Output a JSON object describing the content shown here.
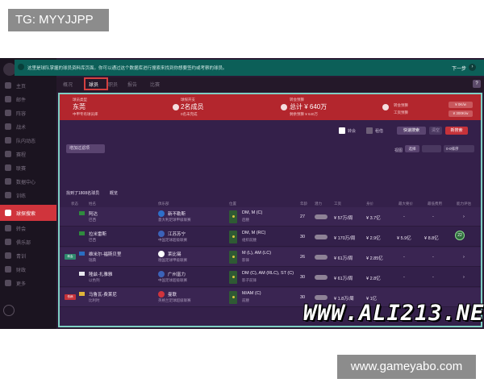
{
  "labels": {
    "tg": "TG: MYYJJPP",
    "site": "www.gameyabo.com",
    "watermark": "WWW.ALI213.NET"
  },
  "banner": {
    "text": "这里是球队掌握的球员资料库页面。你可以通过这个数据库进行搜索来找到你想要签约或考察的球员。",
    "next_label": "下一步",
    "next_icon": "chevron-right-icon"
  },
  "sidebar": {
    "items": [
      {
        "label": "主页"
      },
      {
        "label": "邮件"
      },
      {
        "label": "阵容"
      },
      {
        "label": "战术"
      },
      {
        "label": "队内动态"
      },
      {
        "label": "赛程"
      },
      {
        "label": "联赛"
      },
      {
        "label": "数据中心"
      },
      {
        "label": "训练"
      },
      {
        "label": "医疗"
      },
      {
        "label": "球探搜索"
      },
      {
        "label": "转会"
      },
      {
        "label": "俱乐部"
      },
      {
        "label": "青训"
      },
      {
        "label": "财政"
      },
      {
        "label": "更多"
      }
    ],
    "active_index": 10
  },
  "tabs": [
    {
      "label": "概况"
    },
    {
      "label": "球员"
    },
    {
      "label": "职员"
    },
    {
      "label": "报告"
    },
    {
      "label": "比赛"
    }
  ],
  "header": {
    "team_label": "球员类型",
    "team_name": "东莞",
    "team_sub": "中甲专有球员库",
    "scouting_label": "球探开支",
    "scouting_value": "2名成员",
    "scouting_sub": "0名未完成",
    "budget_label": "转会预算",
    "budget_value": "总计 ¥ 640万",
    "budget_sub": "剩余预算 ¥ 640万",
    "pill1": "转会预算",
    "pill2": "工资预算",
    "pill_right_1": "¥ 0K/w",
    "pill_right_2": "¥ 300K/w"
  },
  "toolbar": {
    "check1_label": "转会",
    "check2_label": "租借",
    "quick_search": "快速搜索",
    "clear": "清空",
    "new_search": "新搜索"
  },
  "filters": {
    "add_filter": "增加过滤项",
    "sort_label": "视图",
    "sort_value": "选择",
    "sort_order": "0-0排序"
  },
  "results": {
    "summary": "找到了1808名球员",
    "view": "概览"
  },
  "columns": [
    "状态",
    "姓名",
    "俱乐部",
    "位置",
    "年龄",
    "潜力",
    "工资",
    "身价",
    "最大要价",
    "最低费用",
    "能力评估"
  ],
  "rows": [
    {
      "name": "阿达",
      "nat": "巴西",
      "club": "新不勒斯",
      "club_sub": "意大利足球甲级联赛",
      "pos": "DM, M (C)",
      "pos_sub": "后腰",
      "age": "27",
      "wage": "¥ 57万/周",
      "value": "¥ 3.7亿",
      "max": "-",
      "min": "-",
      "tag": ""
    },
    {
      "name": "拉米雷斯",
      "nat": "巴西",
      "club": "江苏苏宁",
      "club_sub": "中国足球超级联赛",
      "pos": "DM, M (RC)",
      "pos_sub": "组织前腰",
      "age": "30",
      "wage": "¥ 170万/周",
      "value": "¥ 2.9亿",
      "max": "¥ 5.9亿",
      "min": "¥ 8.8亿",
      "tag": "",
      "rating": "22"
    },
    {
      "name": "维米尔-福斯贝里",
      "nat": "瑞典",
      "club": "莱比锡",
      "club_sub": "德国足球甲级联赛",
      "pos": "M (L), AM (LC)",
      "pos_sub": "影锋",
      "age": "26",
      "wage": "¥ 61万/周",
      "value": "¥ 2.85亿",
      "max": "-",
      "min": "-",
      "tag": "转会"
    },
    {
      "name": "隆兹-扎雅雅",
      "nat": "以色列",
      "club": "广州富力",
      "club_sub": "中国足球超级联赛",
      "pos": "DM (C), AM (RLC), ST (C)",
      "pos_sub": "影子前锋",
      "age": "30",
      "wage": "¥ 61万/周",
      "value": "¥ 2.8亿",
      "max": "-",
      "min": "-",
      "tag": ""
    },
    {
      "name": "马鲁瓦-费莱尼",
      "nat": "比利时",
      "club": "曼联",
      "club_sub": "英格兰足球超级联赛",
      "pos": "M/AM (C)",
      "pos_sub": "前腰",
      "age": "30",
      "wage": "¥ 1.8万/周",
      "value": "¥ 1亿",
      "max": "-",
      "min": "-",
      "tag": "伤病"
    }
  ],
  "colors": {
    "accent": "#b3262d",
    "banner": "#0c5f58",
    "highlight": "#7fd0c4"
  }
}
